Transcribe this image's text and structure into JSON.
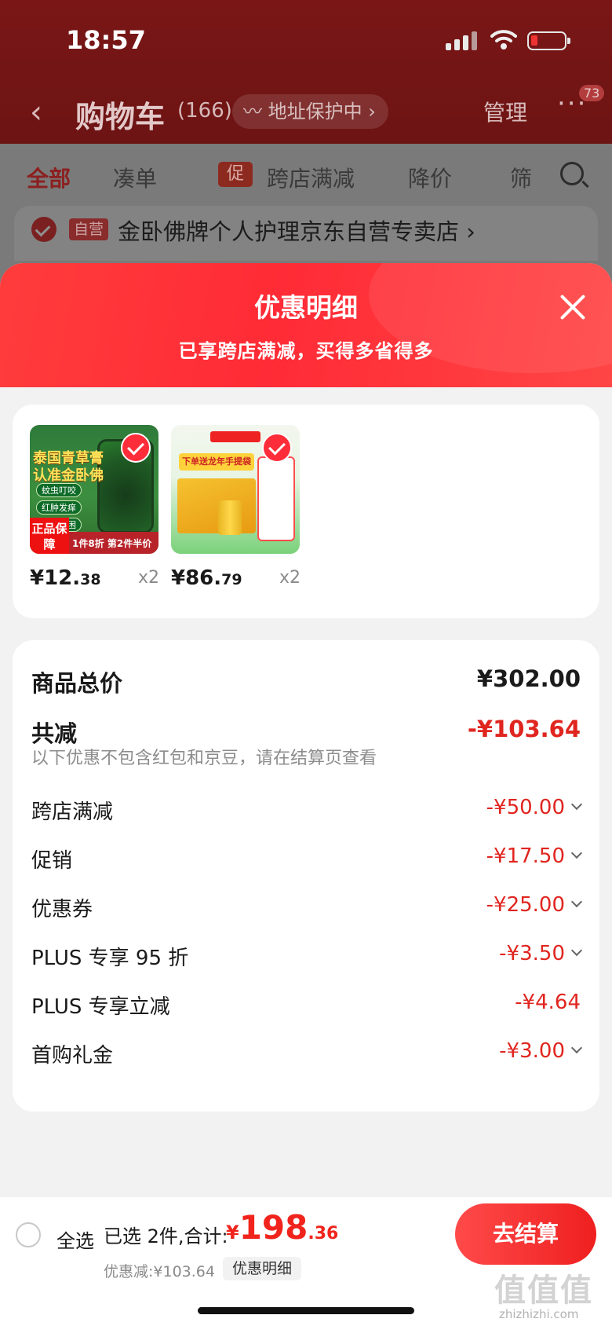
{
  "status_bar": {
    "time": "18:57"
  },
  "nav": {
    "title": "购物车",
    "count": "(166)",
    "address_protect": "地址保护中",
    "manage": "管理",
    "more": "···",
    "badge": "73"
  },
  "tabs": [
    {
      "label": "全部"
    },
    {
      "label": "凑单"
    },
    {
      "label": "跨店满减",
      "tag": "促"
    },
    {
      "label": "降价"
    },
    {
      "label": "筛"
    }
  ],
  "store": {
    "tag": "自营",
    "name": "金卧佛牌个人护理京东自营专卖店 ›"
  },
  "sheet": {
    "title": "优惠明细",
    "subtitle": "已享跨店满减，买得多省得多"
  },
  "products": [
    {
      "price_int": "¥12.",
      "price_dec": "38",
      "qty": "x2",
      "img_text": {
        "line1": "泰国青草膏",
        "line2": "认准金卧佛",
        "pills": [
          "蚊虫叮咬",
          "红肿发痒",
          "清凉解困"
        ],
        "badge": "正品保障",
        "promo": "1件8折 第2件半价"
      }
    },
    {
      "price_int": "¥86.",
      "price_dec": "79",
      "qty": "x2",
      "img_text": {
        "banner": "下单送龙年手提袋"
      }
    }
  ],
  "summary": {
    "goods_total_label": "商品总价",
    "goods_total_value": "¥302.00",
    "reduce_label": "共减",
    "reduce_value": "-¥103.64",
    "note": "以下优惠不包含红包和京豆，请在结算页查看",
    "items": [
      {
        "label": "跨店满减",
        "value": "-¥50.00",
        "expandable": true
      },
      {
        "label": "促销",
        "value": "-¥17.50",
        "expandable": true
      },
      {
        "label": "优惠券",
        "value": "-¥25.00",
        "expandable": true
      },
      {
        "label": "PLUS 专享 95 折",
        "value": "-¥3.50",
        "expandable": true
      },
      {
        "label": "PLUS 专享立减",
        "value": "-¥4.64",
        "expandable": false
      },
      {
        "label": "首购礼金",
        "value": "-¥3.00",
        "expandable": true
      }
    ]
  },
  "bottom": {
    "select_all": "全选",
    "selected_text": "已选 2件,合计:",
    "total_yen": "¥",
    "total_int": "198",
    "total_dec": ".36",
    "discount": "优惠减:¥103.64",
    "detail_btn": "优惠明细",
    "checkout": "去结算"
  },
  "watermark": {
    "big": "值值值",
    "small": "zhizhizhi.com"
  },
  "colors": {
    "accent": "#ff2d3a",
    "discount": "#e0251f",
    "header_dim": "#7a1616"
  }
}
